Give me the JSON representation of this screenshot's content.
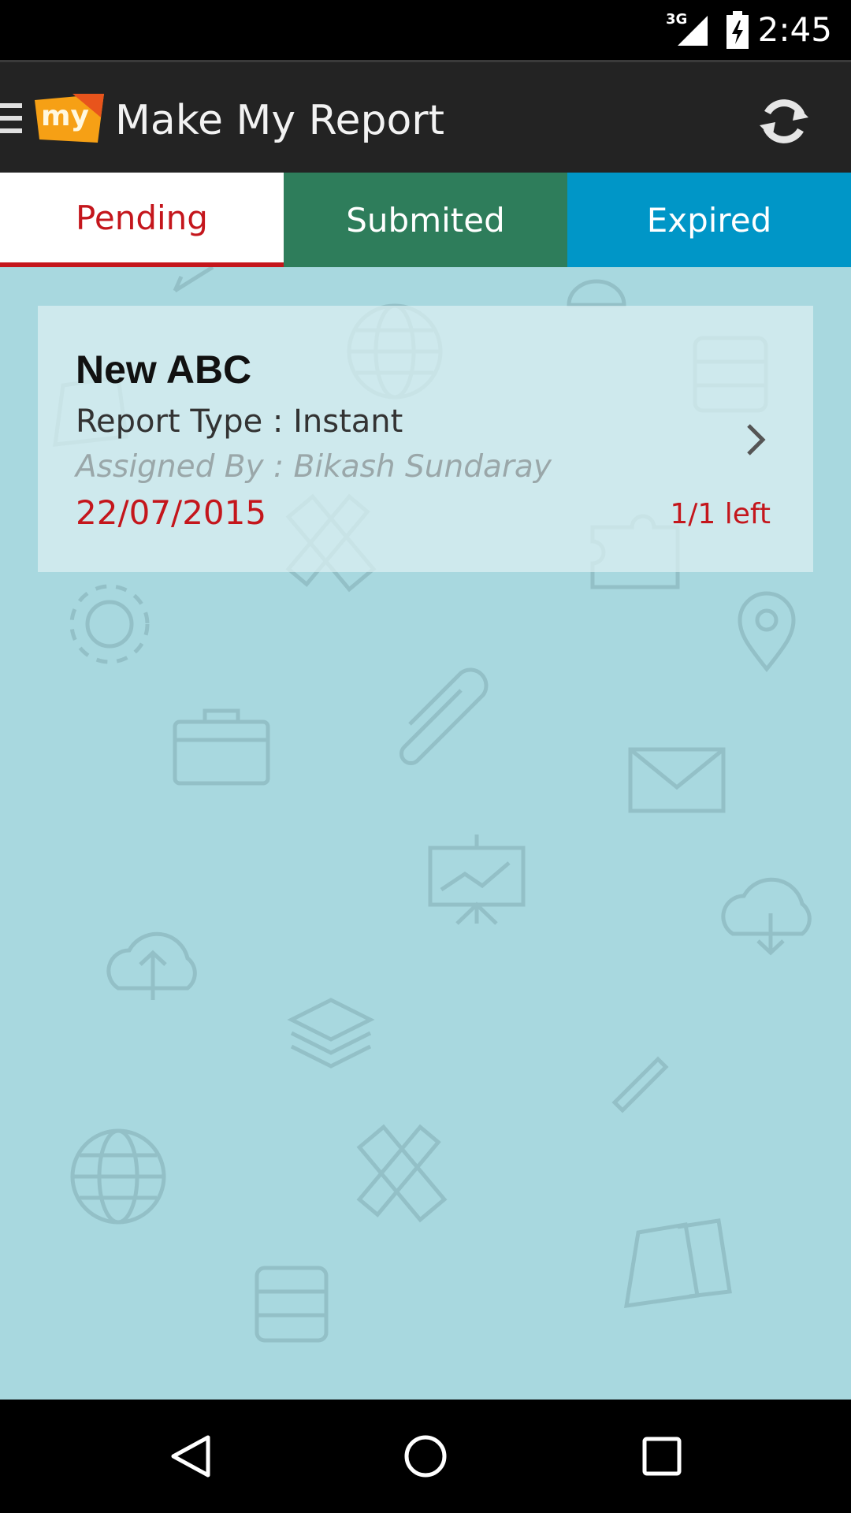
{
  "status_bar": {
    "network": "3G",
    "time": "2:45"
  },
  "app_bar": {
    "logo_text": "my",
    "title": "Make My Report",
    "refresh_icon": "refresh-icon",
    "menu_icon": "menu-icon"
  },
  "tabs": [
    {
      "label": "Pending",
      "selected": true,
      "color": "#c4161c"
    },
    {
      "label": "Submited",
      "selected": false,
      "color": "#2e7d5b"
    },
    {
      "label": "Expired",
      "selected": false,
      "color": "#0096c7"
    }
  ],
  "report": {
    "title": "New ABC",
    "type": "Report Type : Instant",
    "assigned_by": "Assigned By : Bikash Sundaray",
    "date": "22/07/2015",
    "remaining": "1/1 left"
  },
  "colors": {
    "accent_red": "#c4161c",
    "background": "#a8d8df",
    "app_bar": "#232323"
  },
  "nav_bar": {
    "back_icon": "back-icon",
    "home_icon": "home-icon",
    "recents_icon": "recents-icon"
  }
}
